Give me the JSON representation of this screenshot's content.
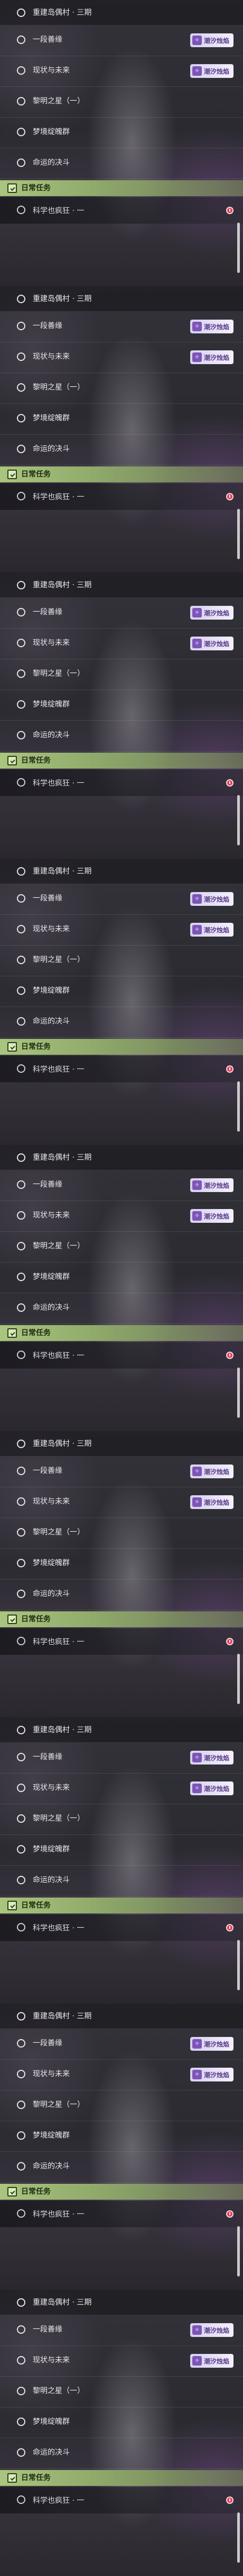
{
  "quest_list": {
    "items": [
      {
        "label": "重建岛偶村 · 三期",
        "badge": null
      },
      {
        "label": "一段善缘",
        "badge": "潮汐烛焰"
      },
      {
        "label": "现状与未来",
        "badge": "潮汐烛焰"
      },
      {
        "label": "黎明之星（一）",
        "badge": null
      },
      {
        "label": "梦境绽魄群",
        "badge": null
      },
      {
        "label": "命运的决斗",
        "badge": null
      }
    ]
  },
  "daily": {
    "header": "日常任务",
    "item": "科学也疯狂 · 一"
  },
  "badge_icon_glyph": "✧",
  "colors": {
    "badge_bg": "#e9e3f6",
    "badge_text": "#5b3f8c",
    "daily_header": "#a9c57e",
    "alert": "#e0405a"
  },
  "icons": {
    "quest_status": "circle-outline-icon",
    "daily": "checkbox-icon",
    "alert": "alert-dot-icon",
    "badge": "sparkle-icon"
  },
  "panel_count": 9
}
